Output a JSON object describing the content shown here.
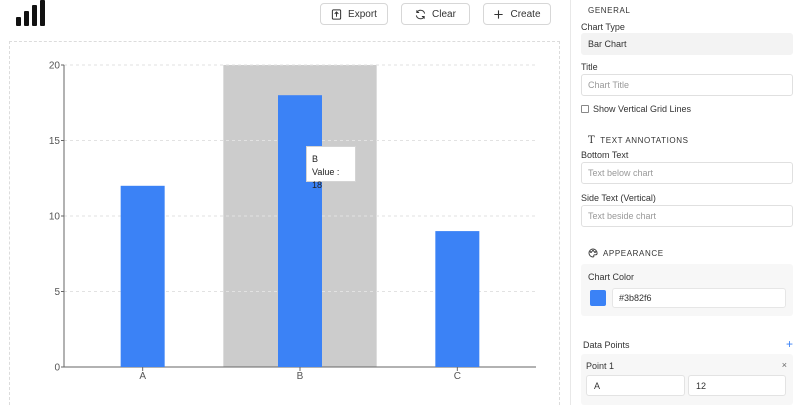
{
  "toolbar": {
    "export_label": "Export",
    "clear_label": "Clear",
    "create_label": "Create"
  },
  "chart_data": {
    "type": "bar",
    "categories": [
      "A",
      "B",
      "C"
    ],
    "values": [
      12,
      18,
      9
    ],
    "ylim": [
      0,
      20
    ],
    "yticks": [
      0,
      5,
      10,
      15,
      20
    ],
    "grid": "horizontal dashed",
    "color": "#3b82f6",
    "highlighted_category": "B"
  },
  "tooltip": {
    "category": "B",
    "value_text": "Value : 18"
  },
  "panel": {
    "general": {
      "section_title": "GENERAL",
      "chart_type_label": "Chart Type",
      "chart_type_value": "Bar Chart",
      "title_label": "Title",
      "title_placeholder": "Chart Title",
      "grid_checkbox_label": "Show Vertical Grid Lines",
      "grid_checked": false
    },
    "text_annotations": {
      "section_title": "TEXT ANNOTATIONS",
      "bottom_label": "Bottom Text",
      "bottom_placeholder": "Text below chart",
      "side_label": "Side Text (Vertical)",
      "side_placeholder": "Text beside chart"
    },
    "appearance": {
      "section_title": "APPEARANCE",
      "color_label": "Chart Color",
      "color_value": "#3b82f6"
    },
    "data_points": {
      "label": "Data Points",
      "add_symbol": "+",
      "points": [
        {
          "title": "Point 1",
          "name": "A",
          "value": "12",
          "close_symbol": "×"
        }
      ]
    }
  }
}
